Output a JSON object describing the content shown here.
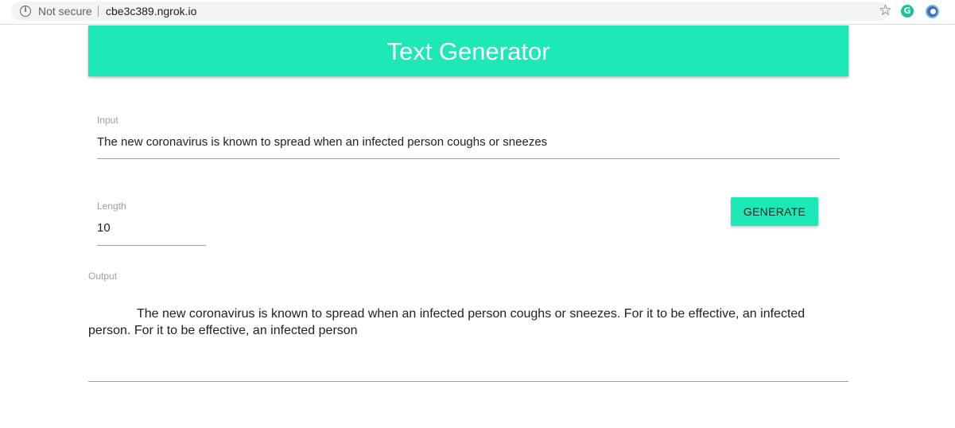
{
  "browser": {
    "security_label": "Not secure",
    "url": "cbe3c389.ngrok.io",
    "icons": [
      "info-icon",
      "star-icon",
      "grammarly-extension-icon",
      "extension-icon"
    ]
  },
  "header": {
    "title": "Text Generator",
    "color": "#1de9b6"
  },
  "input_field": {
    "label": "Input",
    "value": "The new coronavirus is known to spread when an infected person coughs or sneezes"
  },
  "length_field": {
    "label": "Length",
    "value": "10"
  },
  "generate_button": {
    "label": "GENERATE"
  },
  "output": {
    "label": "Output",
    "text": "The new coronavirus is known to spread when an infected person coughs or sneezes. For it to be effective, an infected person. For it to be effective, an infected person"
  }
}
